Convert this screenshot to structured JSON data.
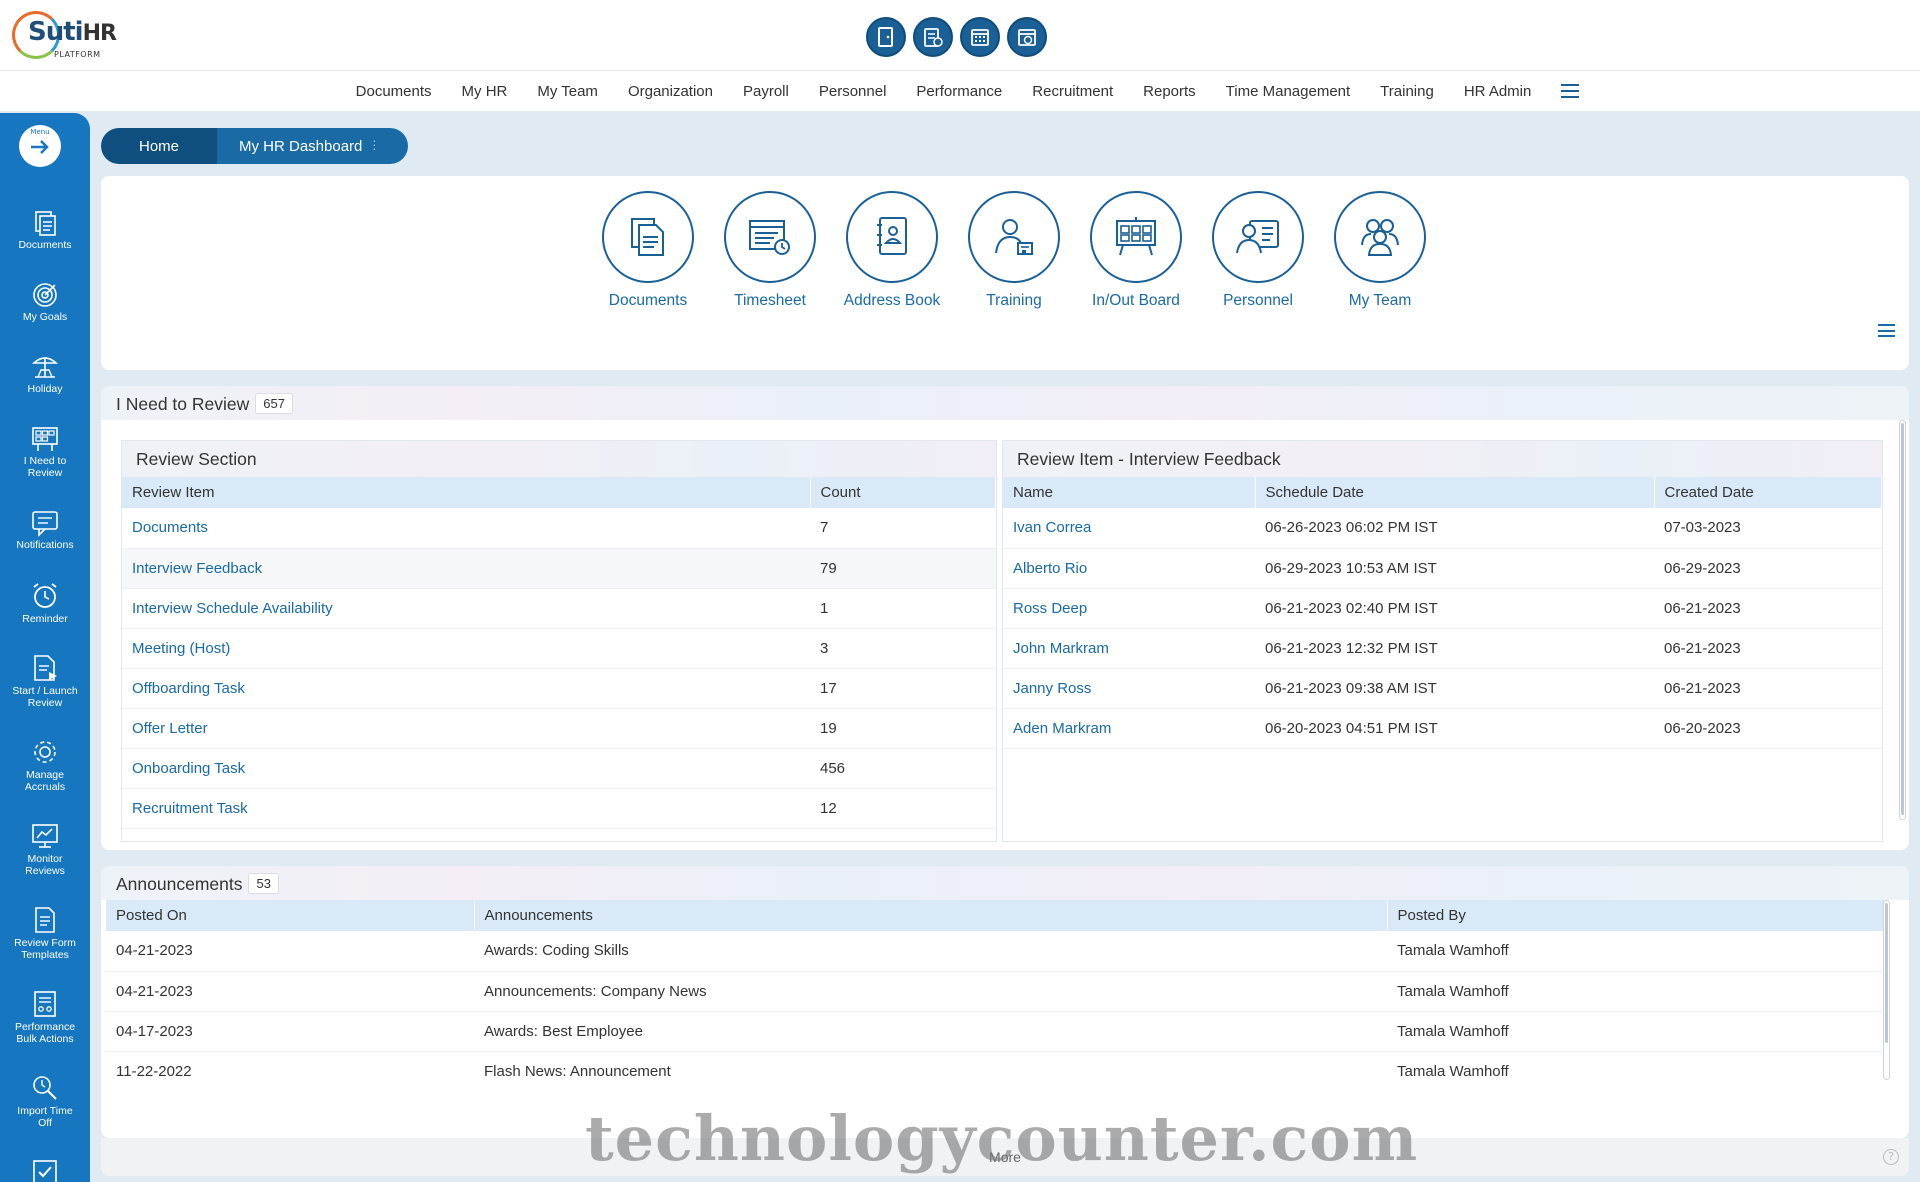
{
  "brand": {
    "name": "Suti",
    "name_suffix": "HR",
    "tagline": "PLATFORM"
  },
  "quick_icons": [
    "door-exit-icon",
    "timesheet-calendar-icon",
    "calendar-grid-icon",
    "calendar-clock-icon"
  ],
  "nav": {
    "items": [
      "Documents",
      "My HR",
      "My Team",
      "Organization",
      "Payroll",
      "Personnel",
      "Performance",
      "Recruitment",
      "Reports",
      "Time Management",
      "Training",
      "HR Admin"
    ]
  },
  "rail": {
    "menu_label": "Menu",
    "items": [
      {
        "label1": "Documents",
        "label2": ""
      },
      {
        "label1": "My Goals",
        "label2": ""
      },
      {
        "label1": "Holiday",
        "label2": ""
      },
      {
        "label1": "I Need to",
        "label2": "Review"
      },
      {
        "label1": "Notifications",
        "label2": ""
      },
      {
        "label1": "Reminder",
        "label2": ""
      },
      {
        "label1": "Start / Launch",
        "label2": "Review"
      },
      {
        "label1": "Manage",
        "label2": "Accruals"
      },
      {
        "label1": "Monitor",
        "label2": "Reviews"
      },
      {
        "label1": "Review Form",
        "label2": "Templates"
      },
      {
        "label1": "Performance",
        "label2": "Bulk Actions"
      },
      {
        "label1": "Import Time",
        "label2": "Off"
      }
    ]
  },
  "breadcrumb": {
    "home": "Home",
    "current": "My HR Dashboard",
    "dots": "⋮"
  },
  "quick_links": [
    {
      "label": "Documents",
      "icon": "documents-icon"
    },
    {
      "label": "Timesheet",
      "icon": "timesheet-icon"
    },
    {
      "label": "Address Book",
      "icon": "address-book-icon"
    },
    {
      "label": "Training",
      "icon": "training-icon"
    },
    {
      "label": "In/Out Board",
      "icon": "in-out-board-icon"
    },
    {
      "label": "Personnel",
      "icon": "personnel-icon"
    },
    {
      "label": "My Team",
      "icon": "my-team-icon"
    }
  ],
  "review": {
    "title": "I Need to Review",
    "count": "657",
    "section": {
      "title": "Review Section",
      "columns": [
        "Review Item",
        "Count"
      ],
      "rows": [
        {
          "item": "Documents",
          "count": "7"
        },
        {
          "item": "Interview Feedback",
          "count": "79"
        },
        {
          "item": "Interview Schedule Availability",
          "count": "1"
        },
        {
          "item": "Meeting (Host)",
          "count": "3"
        },
        {
          "item": "Offboarding Task",
          "count": "17"
        },
        {
          "item": "Offer Letter",
          "count": "19"
        },
        {
          "item": "Onboarding Task",
          "count": "456"
        },
        {
          "item": "Recruitment Task",
          "count": "12"
        }
      ]
    },
    "detail": {
      "title": "Review Item - Interview Feedback",
      "columns": [
        "Name",
        "Schedule Date",
        "Created Date"
      ],
      "rows": [
        {
          "name": "Ivan Correa",
          "schedule": "06-26-2023 06:02 PM IST",
          "created": "07-03-2023"
        },
        {
          "name": "Alberto Rio",
          "schedule": "06-29-2023 10:53 AM IST",
          "created": "06-29-2023"
        },
        {
          "name": "Ross Deep",
          "schedule": "06-21-2023 02:40 PM IST",
          "created": "06-21-2023"
        },
        {
          "name": "John Markram",
          "schedule": "06-21-2023 12:32 PM IST",
          "created": "06-21-2023"
        },
        {
          "name": "Janny Ross",
          "schedule": "06-21-2023 09:38 AM IST",
          "created": "06-21-2023"
        },
        {
          "name": "Aden Markram",
          "schedule": "06-20-2023 04:51 PM IST",
          "created": "06-20-2023"
        }
      ]
    }
  },
  "announcements": {
    "title": "Announcements",
    "count": "53",
    "columns": [
      "Posted On",
      "Announcements",
      "Posted By"
    ],
    "rows": [
      {
        "date": "04-21-2023",
        "text": "Awards: Coding Skills",
        "by": "Tamala Wamhoff"
      },
      {
        "date": "04-21-2023",
        "text": "Announcements: Company News",
        "by": "Tamala Wamhoff"
      },
      {
        "date": "04-17-2023",
        "text": "Awards: Best Employee",
        "by": "Tamala Wamhoff"
      },
      {
        "date": "11-22-2022",
        "text": "Flash News: Announcement",
        "by": "Tamala Wamhoff"
      }
    ],
    "more_label": "More",
    "help": "?"
  },
  "watermark": "technologycounter.com",
  "colors": {
    "primary": "#1676c0",
    "dark": "#0f4f80",
    "link": "#1a6aa6",
    "table_header": "#d9e9f8"
  }
}
